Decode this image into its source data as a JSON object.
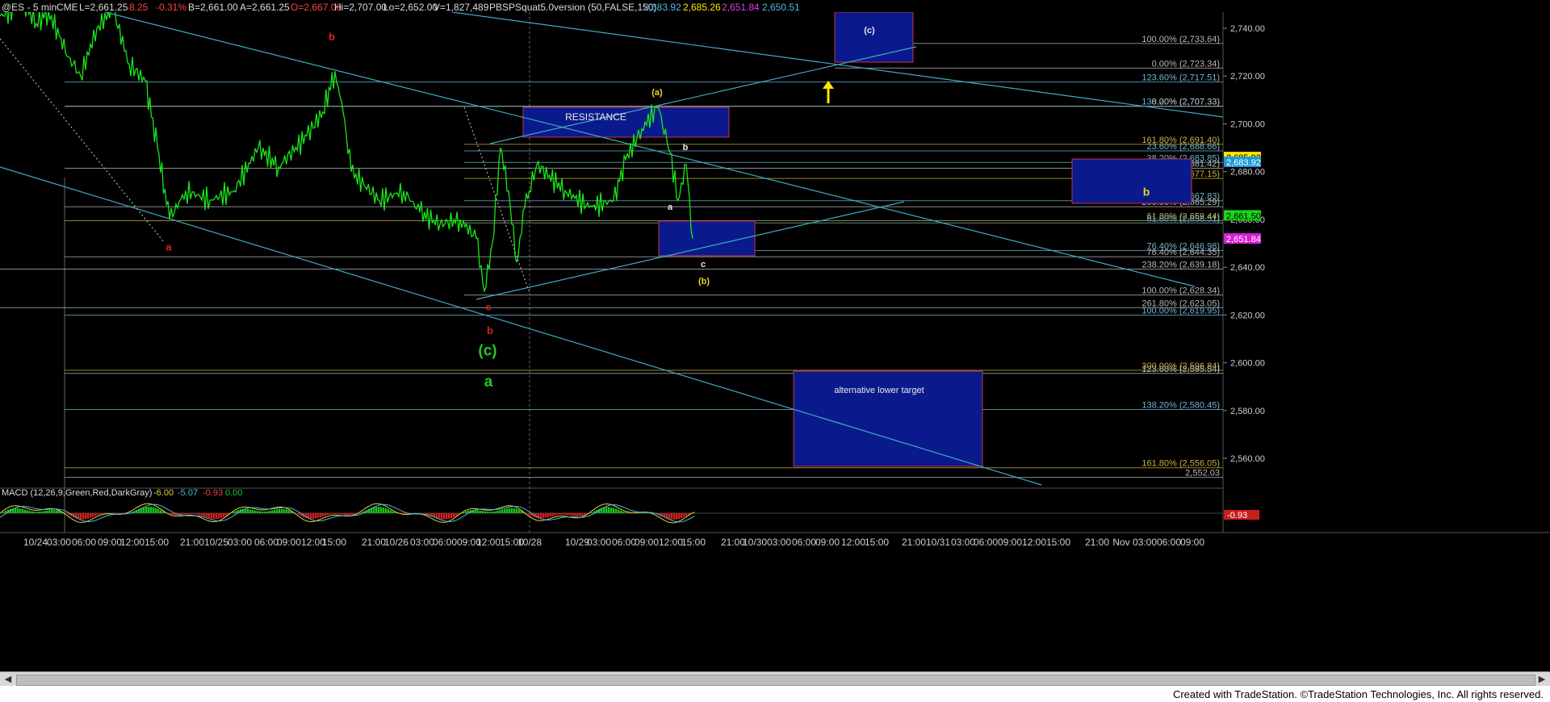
{
  "header": {
    "symbol": "@ES - 5 min",
    "exchange": "CME",
    "last": "L=2,661.25",
    "change": "-8.25",
    "pct": "-0.31%",
    "bid": "B=2,661.00",
    "ask": "A=2,661.25",
    "open": "O=2,667.00",
    "hi": "Hi=2,707.00",
    "lo": "Lo=2,652.00",
    "vol": "V=1,827,489",
    "indicator": "PBSPSquat5.0version (50,FALSE,150)",
    "ind_values": [
      "2,683.92",
      "2,685.26",
      "2,651.84",
      "2,650.51"
    ]
  },
  "colors": {
    "price": "#19e619",
    "channel": "#3fa9c6",
    "box_fill": "#0a1a8c",
    "box_border": "#c8324c",
    "fib_text": "#b8b8b8",
    "wave_red": "#e02020",
    "wave_green": "#22c822",
    "wave_yellow": "#e6d22c",
    "wave_white": "#e8e8e8"
  },
  "chart_data": {
    "type": "line",
    "title": "@ES - 5 min",
    "ylim": [
      2545,
      2755
    ],
    "y_ticks": [
      "2,740.00",
      "2,720.00",
      "2,700.00",
      "2,680.00",
      "2,660.00",
      "2,640.00",
      "2,620.00",
      "2,600.00",
      "2,580.00",
      "2,560.00"
    ],
    "x_ticks": [
      "10/24",
      "03:00",
      "06:00",
      "09:00",
      "12:00",
      "15:00",
      "21:00",
      "10/25",
      "03:00",
      "06:00",
      "09:00",
      "12:00",
      "15:00",
      "21:00",
      "10/26",
      "03:00",
      "06:00",
      "09:00",
      "12:00",
      "15:00",
      "10/28",
      "10/29",
      "03:00",
      "06:00",
      "09:00",
      "12:00",
      "15:00",
      "21:00",
      "10/30",
      "03:00",
      "06:00",
      "09:00",
      "12:00",
      "15:00",
      "21:00",
      "10/31",
      "03:00",
      "06:00",
      "09:00",
      "12:00",
      "15:00",
      "21:00",
      "Nov",
      "03:00",
      "06:00",
      "09:00"
    ],
    "series": [
      {
        "name": "ES",
        "values": [
          [
            0,
            2745
          ],
          [
            30,
            2750
          ],
          [
            45,
            2742
          ],
          [
            60,
            2747
          ],
          [
            85,
            2728
          ],
          [
            100,
            2720
          ],
          [
            120,
            2740
          ],
          [
            140,
            2748
          ],
          [
            160,
            2725
          ],
          [
            180,
            2718
          ],
          [
            195,
            2690
          ],
          [
            210,
            2660
          ],
          [
            230,
            2672
          ],
          [
            260,
            2668
          ],
          [
            290,
            2672
          ],
          [
            320,
            2690
          ],
          [
            345,
            2682
          ],
          [
            380,
            2695
          ],
          [
            400,
            2705
          ],
          [
            415,
            2722
          ],
          [
            425,
            2705
          ],
          [
            435,
            2680
          ],
          [
            470,
            2668
          ],
          [
            500,
            2672
          ],
          [
            520,
            2663
          ],
          [
            545,
            2658
          ],
          [
            570,
            2660
          ],
          [
            590,
            2652
          ],
          [
            600,
            2630
          ],
          [
            610,
            2650
          ],
          [
            620,
            2690
          ],
          [
            630,
            2672
          ],
          [
            640,
            2642
          ],
          [
            650,
            2665
          ],
          [
            665,
            2683
          ],
          [
            700,
            2672
          ],
          [
            730,
            2665
          ],
          [
            760,
            2668
          ],
          [
            775,
            2685
          ],
          [
            795,
            2698
          ],
          [
            815,
            2707
          ],
          [
            830,
            2688
          ],
          [
            840,
            2668
          ],
          [
            850,
            2683
          ],
          [
            858,
            2652
          ]
        ]
      }
    ],
    "fib_levels": [
      {
        "label": "100.00% (2,733.64)",
        "y": 2733.64,
        "color": "#b8b8b8"
      },
      {
        "label": "0.00% (2,723.34)",
        "y": 2723.34,
        "color": "#b8b8b8"
      },
      {
        "label": "123.60% (2,717.51)",
        "y": 2717.51,
        "color": "#6fb6d0"
      },
      {
        "label": "138.20% (2,707.33)",
        "y": 2707.33,
        "color": "#6fb6d0"
      },
      {
        "label": "0.00% (2,707.33)",
        "y": 2707.33,
        "color": "#b8b8b8"
      },
      {
        "label": "161.80% (2,691.40)",
        "y": 2691.4,
        "color": "#c9b23a"
      },
      {
        "label": "23.60% (2,688.66)",
        "y": 2688.66,
        "color": "#6fb6d0"
      },
      {
        "label": "38.20% (2,683.85)",
        "y": 2683.85,
        "color": "#6fb6d0"
      },
      {
        "label": "176.40% (2,681.42)",
        "y": 2681.42,
        "color": "#b8b8b8"
      },
      {
        "label": "38.20% (2,677.15)",
        "y": 2677.15,
        "color": "#c9b23a"
      },
      {
        "label": "50.00% (2,667.83)",
        "y": 2667.83,
        "color": "#6fb6d0"
      },
      {
        "label": "200.00% (2,665.29)",
        "y": 2665.29,
        "color": "#b8b8b8"
      },
      {
        "label": "61.80% (2,659.44)",
        "y": 2659.44,
        "color": "#c9b23a"
      },
      {
        "label": "61.80% (2,658.51)",
        "y": 2658.51,
        "color": "#6fb6d0"
      },
      {
        "label": "76.40% (2,646.98)",
        "y": 2646.98,
        "color": "#6fb6d0"
      },
      {
        "label": "76.40% (2,644.35)",
        "y": 2644.35,
        "color": "#b8b8b8"
      },
      {
        "label": "238.20% (2,639.18)",
        "y": 2639.18,
        "color": "#b8b8b8"
      },
      {
        "label": "100.00% (2,628.34)",
        "y": 2628.34,
        "color": "#b8b8b8"
      },
      {
        "label": "261.80% (2,623.05)",
        "y": 2623.05,
        "color": "#b8b8b8"
      },
      {
        "label": "100.00% (2,619.95)",
        "y": 2619.95,
        "color": "#6fb6d0"
      },
      {
        "label": "300.00% (2,596.84)",
        "y": 2596.84,
        "color": "#c9b23a"
      },
      {
        "label": "123.60% (2,595.54)",
        "y": 2595.54,
        "color": "#b8b8b8"
      },
      {
        "label": "138.20% (2,580.45)",
        "y": 2580.45,
        "color": "#6fb6d0"
      },
      {
        "label": "161.80% (2,556.05)",
        "y": 2556.05,
        "color": "#c9b23a"
      },
      {
        "label": "2,552.03",
        "y": 2552.03,
        "color": "#b8b8b8"
      }
    ],
    "price_tags": [
      {
        "label": "2,685.92",
        "y": 2685.92,
        "bg": "#ffe800",
        "fg": "#000"
      },
      {
        "label": "2,683.92",
        "y": 2683.92,
        "bg": "#1f9ad6",
        "fg": "#fff"
      },
      {
        "label": "2,661.50",
        "y": 2661.5,
        "bg": "#19d419",
        "fg": "#000"
      },
      {
        "label": "2,651.84",
        "y": 2651.84,
        "bg": "#d61fd6",
        "fg": "#fff"
      }
    ],
    "box_labels": {
      "resistance": "RESISTANCE",
      "alt_target": "alternative lower target"
    },
    "wave_labels": [
      {
        "text": "a",
        "x": 209,
        "y": 2647,
        "color": "#e02020",
        "size": 13
      },
      {
        "text": "b",
        "x": 411,
        "y": 2735,
        "color": "#e02020",
        "size": 13
      },
      {
        "text": "c",
        "x": 605,
        "y": 2622,
        "color": "#e02020",
        "size": 12
      },
      {
        "text": "b",
        "x": 607,
        "y": 2612,
        "color": "#e02020",
        "size": 13
      },
      {
        "text": "(c)",
        "x": 604,
        "y": 2603,
        "color": "#22c822",
        "size": 19
      },
      {
        "text": "a",
        "x": 605,
        "y": 2590,
        "color": "#22c822",
        "size": 19
      },
      {
        "text": "(a)",
        "x": 814,
        "y": 2712,
        "color": "#e6d22c",
        "size": 11
      },
      {
        "text": "b",
        "x": 849,
        "y": 2689,
        "color": "#e8e8e8",
        "size": 11
      },
      {
        "text": "a",
        "x": 830,
        "y": 2664,
        "color": "#e8e8e8",
        "size": 11
      },
      {
        "text": "c",
        "x": 871,
        "y": 2640,
        "color": "#e8e8e8",
        "size": 11
      },
      {
        "text": "(b)",
        "x": 872,
        "y": 2633,
        "color": "#e6d22c",
        "size": 11
      },
      {
        "text": "a",
        "x": 1075,
        "y": 2753,
        "color": "#e6d22c",
        "size": 13
      },
      {
        "text": "(c)",
        "x": 1077,
        "y": 2738,
        "color": "#e8e8e8",
        "size": 11
      },
      {
        "text": "b",
        "x": 1420,
        "y": 2670,
        "color": "#e6d22c",
        "size": 14
      }
    ]
  },
  "macd": {
    "label": "MACD (12,26,9,Green,Red,DarkGray)",
    "values": [
      "-6.00",
      "-5.07",
      "-0.93",
      "0.00"
    ],
    "axis_tag": "-0.93"
  },
  "footer": {
    "credit": "Created with TradeStation. ©TradeStation Technologies, Inc. All rights reserved."
  }
}
